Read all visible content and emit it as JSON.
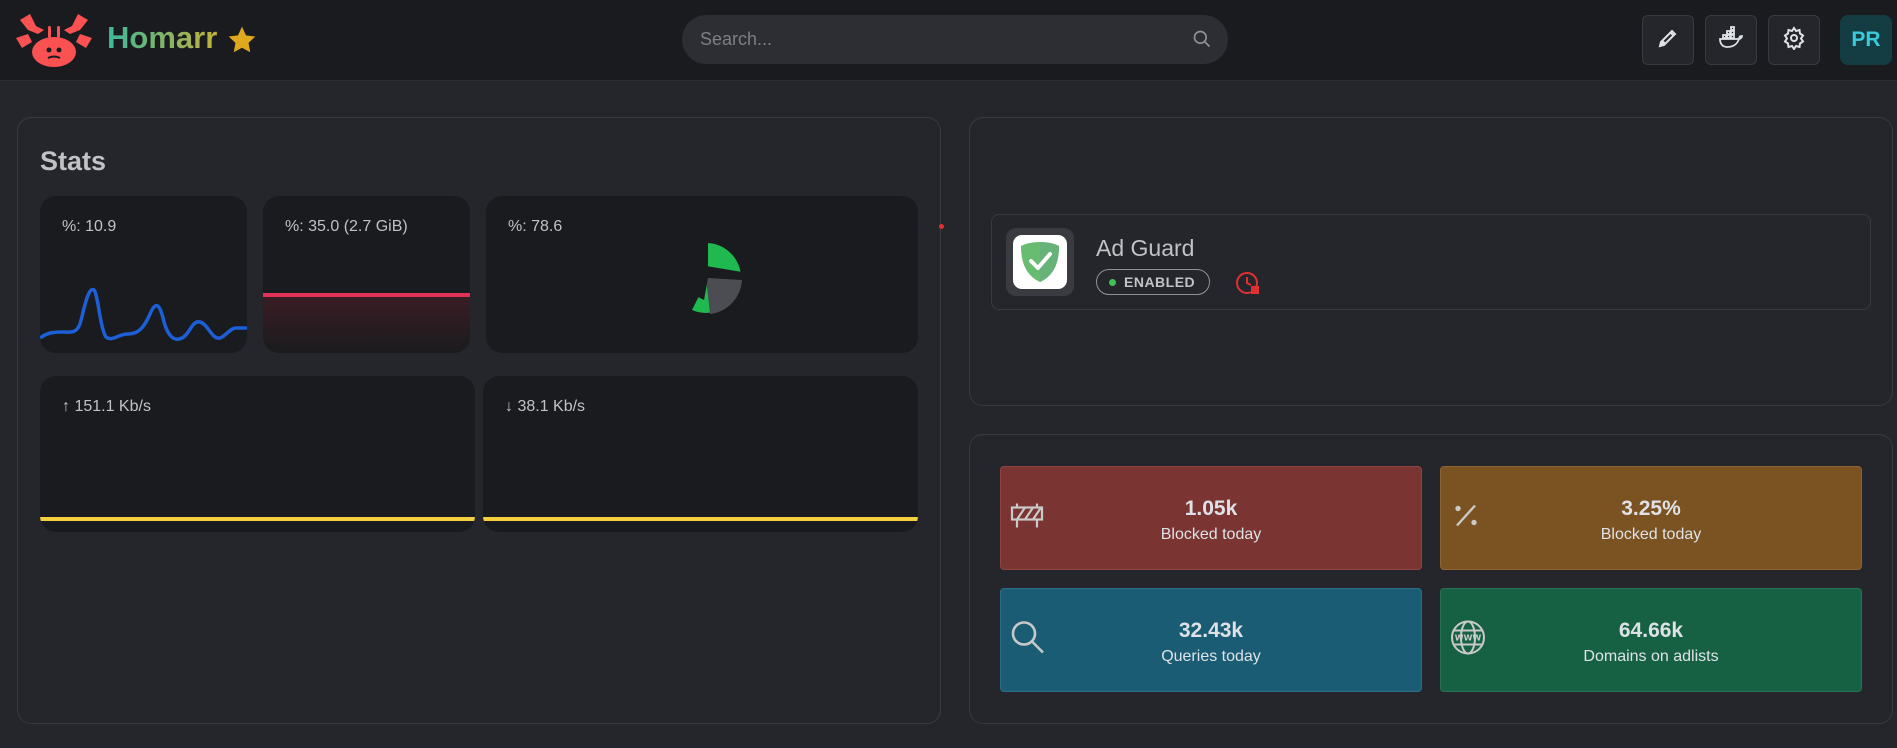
{
  "header": {
    "app_name": "Homarr",
    "search_placeholder": "Search...",
    "avatar_initials": "PR",
    "buttons": [
      "edit-mode",
      "docker",
      "settings"
    ]
  },
  "stats": {
    "title": "Stats",
    "cpu_label": "%: 10.9",
    "memory_label": "%: 35.0 (2.7 GiB)",
    "disk_label": "%: 78.6",
    "upload_label": "↑ 151.1 Kb/s",
    "download_label": "↓ 38.1 Kb/s",
    "colors": {
      "cpu": "#1c5fd6",
      "memory": "#e03157",
      "disk": "#1fb94f",
      "network": "#f4d03f"
    }
  },
  "adguard": {
    "name": "Ad Guard",
    "status": "ENABLED"
  },
  "dns_stats": [
    {
      "value": "1.05k",
      "caption": "Blocked today",
      "color": "#7a3432",
      "icon": "barrier-icon"
    },
    {
      "value": "3.25%",
      "caption": "Blocked today",
      "color": "#7b5222",
      "icon": "percent-icon"
    },
    {
      "value": "32.43k",
      "caption": "Queries today",
      "color": "#1a5c73",
      "icon": "search-icon"
    },
    {
      "value": "64.66k",
      "caption": "Domains on adlists",
      "color": "#166144",
      "icon": "www-icon"
    }
  ]
}
